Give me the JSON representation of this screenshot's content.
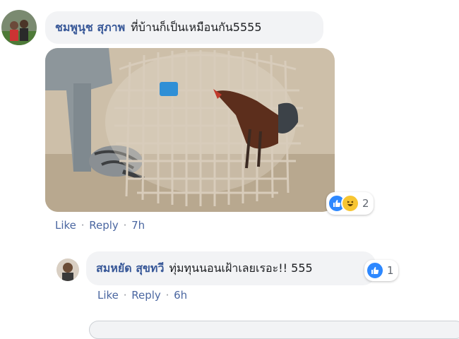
{
  "comment1": {
    "author": "ชมพูนุช สุภาพ",
    "text": "ที่บ้านก็เป็นเหมือนกัน5555",
    "reaction_count": "2",
    "reactions": [
      "like-icon",
      "haha-icon"
    ],
    "actions": {
      "like": "Like",
      "reply": "Reply",
      "time": "7h"
    }
  },
  "reply1": {
    "author": "สมหยัด สุขทวี",
    "text": "ทุ่มทุนนอนเฝ้าเลยเรอะ!! 555",
    "reaction_count": "1",
    "reactions": [
      "like-icon"
    ],
    "actions": {
      "like": "Like",
      "reply": "Reply",
      "time": "6h"
    }
  },
  "colors": {
    "link": "#4b67a1",
    "author": "#385898",
    "bubble": "#f2f3f5",
    "like": "#2d88ff"
  }
}
